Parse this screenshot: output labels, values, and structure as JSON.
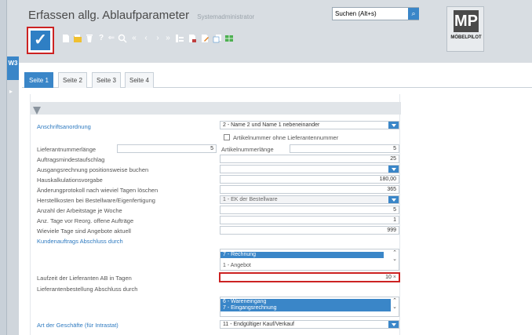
{
  "header": {
    "title": "Erfassen allg. Ablaufparameter",
    "subtitle": "Systemadministrator",
    "search_value": "Suchen (Alt+s)",
    "left_tab_label": "W3",
    "logo_letters": "MP",
    "logo_text": "MÖBELPILOT"
  },
  "toolbar": {
    "icons": [
      "save-icon",
      "new-icon",
      "folder-icon",
      "delete-icon",
      "help-icon",
      "back-icon",
      "zoom-icon",
      "first-icon",
      "prev-icon",
      "next-icon",
      "last-icon",
      "tree-icon",
      "doc-icon",
      "doc-edit-icon",
      "copy-icon",
      "grid-icon"
    ],
    "glyphs": {
      "help": "?",
      "back": "⇐",
      "first": "«",
      "prev": "‹",
      "next": "›",
      "last": "»"
    }
  },
  "tabs": [
    {
      "label": "Seite 1",
      "active": true
    },
    {
      "label": "Seite 2",
      "active": false
    },
    {
      "label": "Seite 3",
      "active": false
    },
    {
      "label": "Seite 4",
      "active": false
    }
  ],
  "form": {
    "anschrift_label": "Anschriftsanordnung",
    "anschrift_value": "2 - Name 2 und Name 1 nebeneinander",
    "ohne_lief_label": "Artikelnummer ohne Lieferantennummer",
    "lieferantennr_label": "Lieferantnummerlänge",
    "lieferantennr_value": "5",
    "artikelnr_label": "Artikelnummerlänge",
    "artikelnr_value": "5",
    "aufschlag_label": "Auftragsmindestaufschlag",
    "aufschlag_value": "25",
    "ausgang_label": "Ausgangsrechnung positionsweise buchen",
    "hauskalk_label": "Hauskalkulationsvorgabe",
    "hauskalk_value": "180,00",
    "aenderung_label": "Änderungprotokoll nach wieviel Tagen löschen",
    "aenderung_value": "365",
    "herstell_label": "Herstellkosten bei Bestellware/Eigenfertigung",
    "herstell_value": "1 - EK der Bestellware",
    "arbeitstage_label": "Anzahl der Arbeitstage je Woche",
    "arbeitstage_value": "5",
    "reorg_label": "Anz. Tage vor Reorg. offene Aufträge",
    "reorg_value": "1",
    "angebote_label": "Wieviele Tage sind Angebote aktuell",
    "angebote_value": "999",
    "kunden_label": "Kundenauftrags Abschluss durch",
    "kunden_items": [
      "7 - Rechnung",
      "1 - Angebot"
    ],
    "laufzeit_label": "Laufzeit der Lieferanten AB in Tagen",
    "laufzeit_value": "10",
    "laufzeit_clear": "×",
    "lief_best_label": "Lieferantenbestellung Abschluss durch",
    "lief_best_items": [
      "6 - Wareneingang",
      "7 - Eingangsrechnung"
    ],
    "geschaefte_label": "Art der Geschäfte (für Intrastat)",
    "geschaefte_value": "11 - Endgültiger Kauf/Verkauf"
  }
}
